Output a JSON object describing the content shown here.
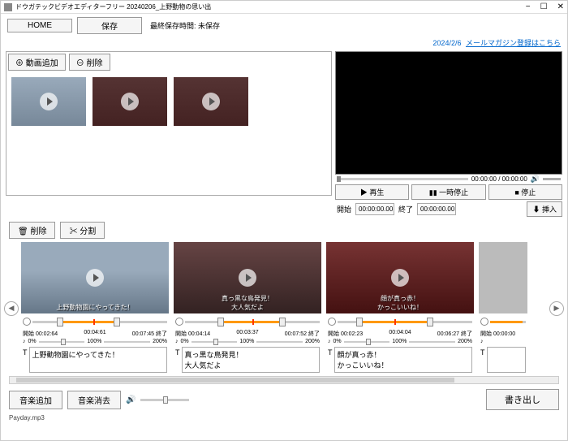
{
  "title": "ドウガテックビデオエディターフリー 20240206_上野動物の思い出",
  "toolbar": {
    "home": "HOME",
    "save": "保存",
    "last_save_label": "最終保存時間: 未保存"
  },
  "infobar": {
    "date": "2024/2/6",
    "maillink": "メールマガジン登録はこちら"
  },
  "library": {
    "add": "動画追加",
    "delete": "削除",
    "add_icon": "⊕",
    "del_icon": "⊖"
  },
  "preview": {
    "time": "00:00:00 / 00:00:00",
    "play": "▶ 再生",
    "pause": "▮▮ 一時停止",
    "stop": "■ 停止",
    "start_lbl": "開始",
    "start_time": "00:00:00.00",
    "end_lbl": "終了",
    "end_time": "00:00:00.00",
    "insert": "⬇ 挿入"
  },
  "midtools": {
    "delete": "🗑 削除",
    "split": "✂ 分割"
  },
  "clips": [
    {
      "caption": "上野動物園にやってきた！",
      "start_lbl": "開始",
      "start": "00:02:64",
      "mid": "00:04:61",
      "end_lbl": "終了",
      "end": "00:07:45",
      "vol0": "0%",
      "vol1": "100%",
      "vol2": "200%",
      "text": "上野動物園にやってきた！"
    },
    {
      "caption": "真っ黒な鳥発見！\n大人気だよ",
      "start_lbl": "開始",
      "start": "00:04:14",
      "mid": "00:03:37",
      "end_lbl": "終了",
      "end": "00:07:52",
      "vol0": "0%",
      "vol1": "100%",
      "vol2": "200%",
      "text": "真っ黒な鳥発見！\n大人気だよ"
    },
    {
      "caption": "顔が真っ赤！\nかっこいいね！",
      "start_lbl": "開始",
      "start": "00:02:23",
      "mid": "00:04:04",
      "end_lbl": "終了",
      "end": "00:06:27",
      "vol0": "0%",
      "vol1": "100%",
      "vol2": "200%",
      "text": "顔が真っ赤！\nかっこいいね！"
    },
    {
      "start_lbl": "開始",
      "start": "00:00:00"
    }
  ],
  "bottom": {
    "add_music": "音楽追加",
    "del_music": "音楽消去",
    "export": "書き出し"
  },
  "status": "Payday.mp3"
}
